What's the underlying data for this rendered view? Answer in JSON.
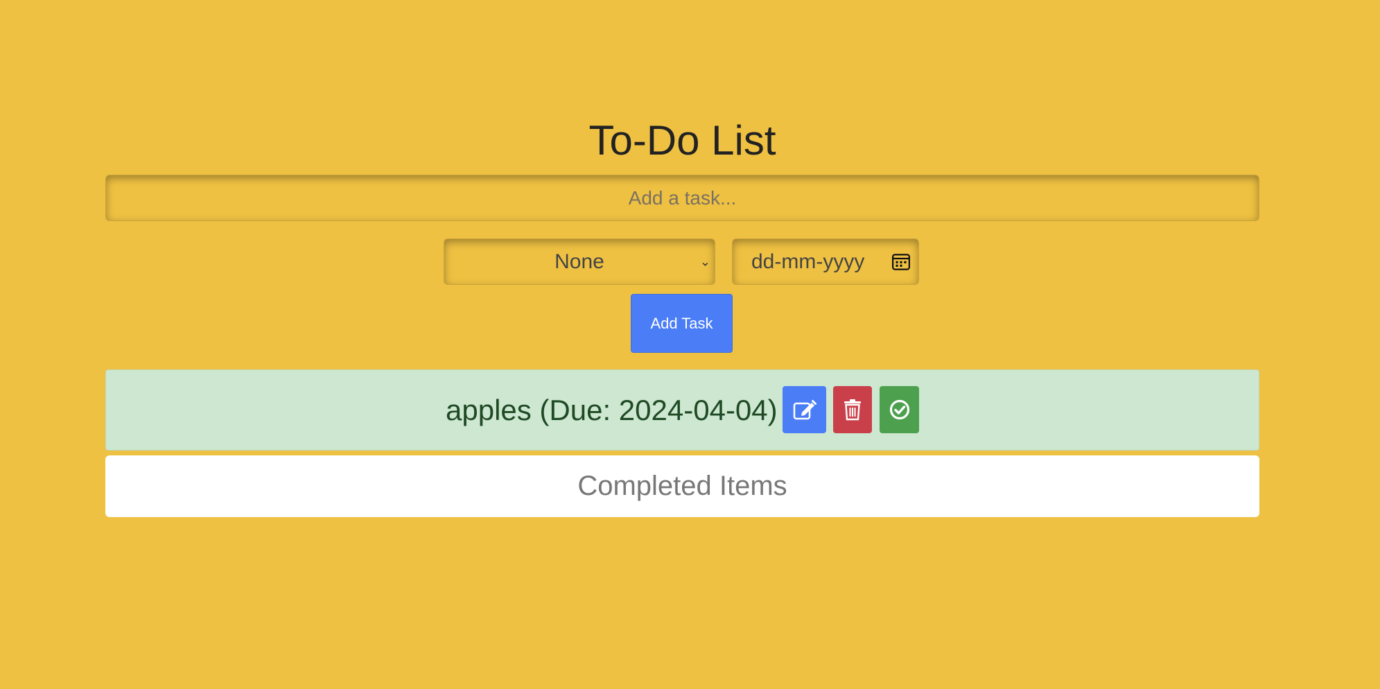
{
  "app": {
    "title": "To-Do List"
  },
  "form": {
    "task_placeholder": "Add a task...",
    "task_value": "",
    "priority_selected": "None",
    "date_placeholder": "dd-mm-yyyy",
    "add_button_label": "Add Task"
  },
  "tasks": [
    {
      "text": "apples (Due: 2024-04-04)",
      "actions": [
        "edit-icon",
        "trash-icon",
        "check-circle-icon"
      ]
    }
  ],
  "completed": {
    "heading": "Completed Items"
  },
  "colors": {
    "background": "#EFC142",
    "primary": "#4A7DF6",
    "danger": "#C9404A",
    "success": "#4CA04E",
    "task_bg": "#CDE7D0"
  }
}
